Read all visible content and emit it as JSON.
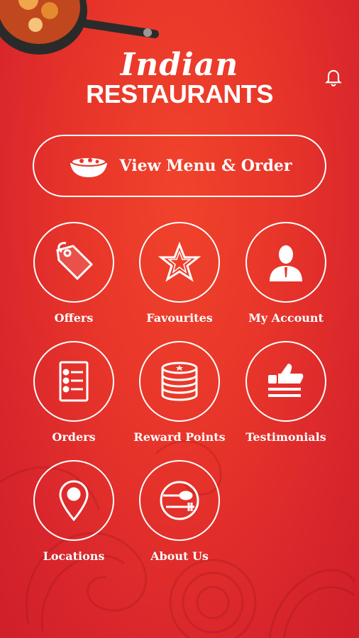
{
  "brand": {
    "line1": "Indian",
    "line2": "RESTAURANTS"
  },
  "header": {
    "notification_icon": "bell-icon"
  },
  "menu_button": {
    "label": "View Menu & Order",
    "icon": "food-bowl-icon"
  },
  "tiles": [
    {
      "label": "Offers",
      "icon": "tag-icon"
    },
    {
      "label": "Favourites",
      "icon": "star-icon"
    },
    {
      "label": "My Account",
      "icon": "person-icon"
    },
    {
      "label": "Orders",
      "icon": "order-list-icon"
    },
    {
      "label": "Reward Points",
      "icon": "coin-stack-icon"
    },
    {
      "label": "Testimonials",
      "icon": "thumbs-up-icon"
    },
    {
      "label": "Locations",
      "icon": "location-pin-icon"
    },
    {
      "label": "About Us",
      "icon": "plate-fork-icon"
    }
  ],
  "colors": {
    "background": "#e8352a",
    "foreground": "#ffffff"
  }
}
